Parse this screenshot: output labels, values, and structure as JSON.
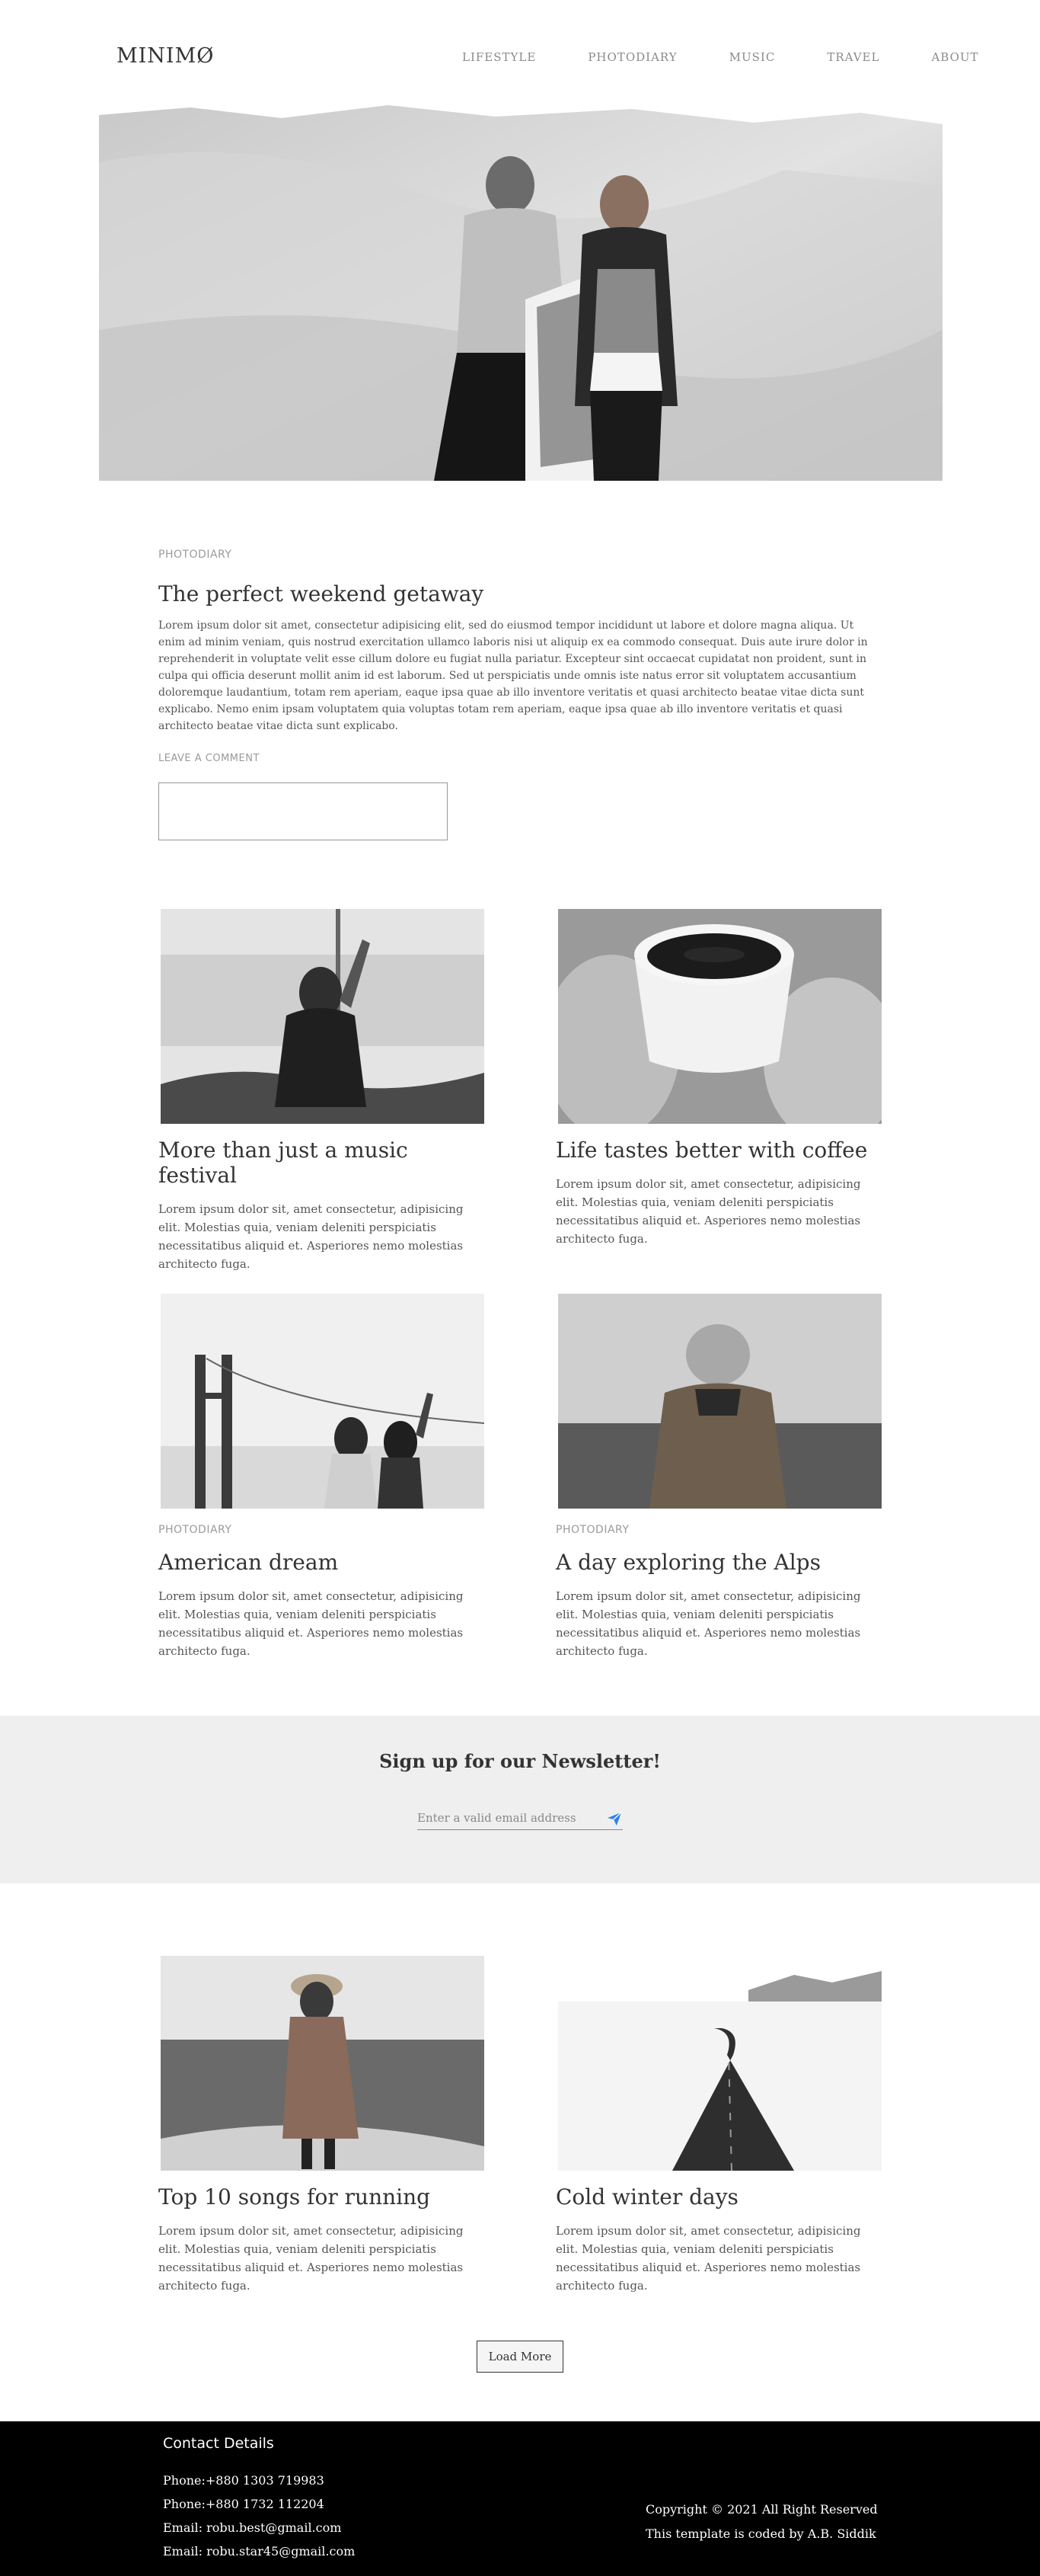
{
  "header": {
    "logo": "MINIMØ",
    "nav": [
      "LIFESTYLE",
      "PHOTODIARY",
      "MUSIC",
      "TRAVEL",
      "ABOUT"
    ]
  },
  "featured": {
    "category": "PHOTODIARY",
    "title": "The perfect weekend getaway",
    "body": "Lorem ipsum dolor sit amet, consectetur adipisicing elit, sed do eiusmod tempor incididunt ut labore et dolore magna aliqua. Ut enim ad minim veniam, quis nostrud exercitation ullamco laboris nisi ut aliquip ex ea commodo consequat. Duis aute irure dolor in reprehenderit in voluptate velit esse cillum dolore eu fugiat nulla pariatur. Excepteur sint occaecat cupidatat non proident, sunt in culpa qui officia deserunt mollit anim id est laborum. Sed ut perspiciatis unde omnis iste natus error sit voluptatem accusantium doloremque laudantium, totam rem aperiam, eaque ipsa quae ab illo inventore veritatis et quasi architecto beatae vitae dicta sunt explicabo. Nemo enim ipsam voluptatem quia voluptas totam rem aperiam, eaque ipsa quae ab illo inventore veritatis et quasi architecto beatae vitae dicta sunt explicabo.",
    "leave_comment": "LEAVE A COMMENT"
  },
  "cards": [
    {
      "category": "",
      "title": "More than just a music festival",
      "body": "Lorem ipsum dolor sit, amet consectetur, adipisicing elit. Molestias quia, veniam deleniti perspiciatis necessitatibus aliquid et. Asperiores nemo molestias architecto fuga.",
      "image": "concert-photo"
    },
    {
      "category": "",
      "title": "Life tastes better with coffee",
      "body": "Lorem ipsum dolor sit, amet consectetur, adipisicing elit. Molestias quia, veniam deleniti perspiciatis necessitatibus aliquid et. Asperiores nemo molestias architecto fuga.",
      "image": "coffee-photo"
    },
    {
      "category": "PHOTODIARY",
      "title": "American dream",
      "body": "Lorem ipsum dolor sit, amet consectetur, adipisicing elit. Molestias quia, veniam deleniti perspiciatis necessitatibus aliquid et. Asperiores nemo molestias architecto fuga.",
      "image": "bridge-photo"
    },
    {
      "category": "PHOTODIARY",
      "title": "A day exploring the Alps",
      "body": "Lorem ipsum dolor sit, amet consectetur, adipisicing elit. Molestias quia, veniam deleniti perspiciatis necessitatibus aliquid et. Asperiores nemo molestias architecto fuga.",
      "image": "hiker-photo"
    },
    {
      "category": "",
      "title": "Top 10 songs for running",
      "body": "Lorem ipsum dolor sit, amet consectetur, adipisicing elit. Molestias quia, veniam deleniti perspiciatis necessitatibus aliquid et. Asperiores nemo molestias architecto fuga.",
      "image": "road-woman-photo"
    },
    {
      "category": "",
      "title": "Cold winter days",
      "body": "Lorem ipsum dolor sit, amet consectetur, adipisicing elit. Molestias quia, veniam deleniti perspiciatis necessitatibus aliquid et. Asperiores nemo molestias architecto fuga.",
      "image": "winter-road-photo"
    }
  ],
  "newsletter": {
    "title": "Sign up for our Newsletter!",
    "placeholder": "Enter a valid email address",
    "send_icon": "paper-plane-icon",
    "send_icon_color": "#2f80ed"
  },
  "load_more": "Load More",
  "footer": {
    "contact_title": "Contact Details",
    "phone1": "Phone:+880 1303 719983",
    "phone2": "Phone:+880 1732 112204",
    "email1": "Email: robu.best@gmail.com",
    "email2": "Email: robu.star45@gmail.com",
    "copyright": "Copyright © 2021 All Right Reserved",
    "credit": "This template is coded by A.B. Siddik"
  },
  "hero_image": "two-women-desert-photo"
}
